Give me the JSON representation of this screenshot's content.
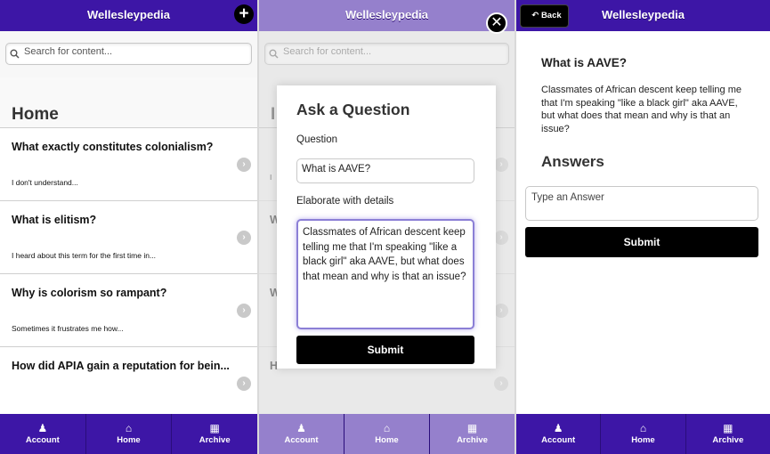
{
  "app_title": "Wellesleypedia",
  "search": {
    "placeholder": "Search for content..."
  },
  "home": {
    "title": "Home",
    "items": [
      {
        "question": "What exactly constitutes colonialism?",
        "detail": "I don't understand..."
      },
      {
        "question": "What is elitism?",
        "detail": "I heard about this term for the first time in..."
      },
      {
        "question": "Why is colorism so rampant?",
        "detail": "Sometimes it frustrates me how..."
      },
      {
        "question": "How did APIA gain a reputation for bein...",
        "detail": ""
      }
    ]
  },
  "footer": {
    "tabs": [
      {
        "label": "Account",
        "icon": "user-icon"
      },
      {
        "label": "Home",
        "icon": "home-icon"
      },
      {
        "label": "Archive",
        "icon": "grid-icon"
      }
    ]
  },
  "ask_dialog": {
    "title": "Ask a Question",
    "question_label": "Question",
    "question_value": "What is AAVE?",
    "details_label": "Elaborate with details",
    "details_value": "Classmates of African descent keep telling me that I'm speaking \"like a black girl\" aka AAVE, but what does that mean and why is that an issue?",
    "submit_label": "Submit",
    "faded_rows": [
      "W",
      "W",
      "W",
      "H",
      "I",
      "I",
      "So"
    ]
  },
  "detail": {
    "back_label": "Back",
    "question": "What is AAVE?",
    "body": "Classmates of African descent keep telling me that I'm speaking \"like a black girl\" aka AAVE, but what does that mean and why is that an issue?",
    "answers_title": "Answers",
    "answer_placeholder": "Type an Answer",
    "submit_label": "Submit"
  },
  "colors": {
    "header": "#3d16a6",
    "header_dimmed": "#9580cc",
    "button": "#000000"
  }
}
